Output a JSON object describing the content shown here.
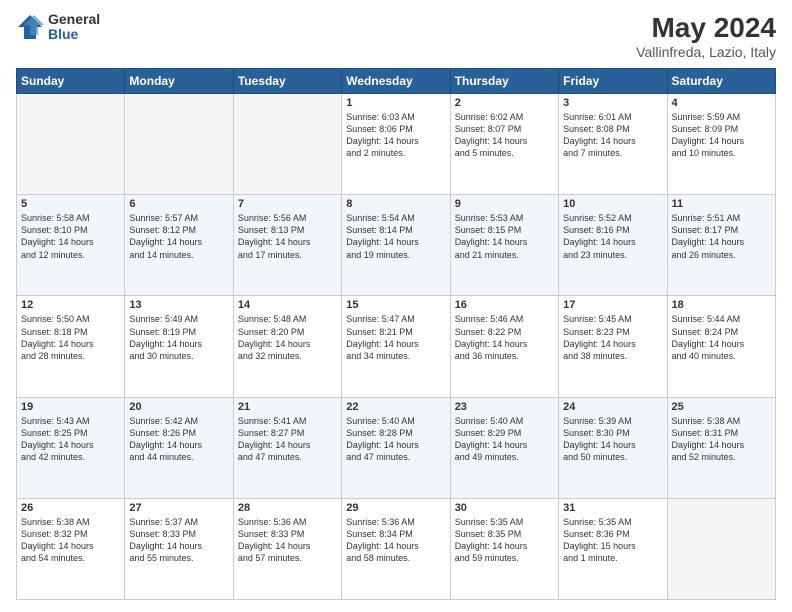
{
  "logo": {
    "general": "General",
    "blue": "Blue"
  },
  "header": {
    "title": "May 2024",
    "subtitle": "Vallinfreda, Lazio, Italy"
  },
  "weekdays": [
    "Sunday",
    "Monday",
    "Tuesday",
    "Wednesday",
    "Thursday",
    "Friday",
    "Saturday"
  ],
  "weeks": [
    [
      {
        "day": "",
        "info": ""
      },
      {
        "day": "",
        "info": ""
      },
      {
        "day": "",
        "info": ""
      },
      {
        "day": "1",
        "info": "Sunrise: 6:03 AM\nSunset: 8:06 PM\nDaylight: 14 hours\nand 2 minutes."
      },
      {
        "day": "2",
        "info": "Sunrise: 6:02 AM\nSunset: 8:07 PM\nDaylight: 14 hours\nand 5 minutes."
      },
      {
        "day": "3",
        "info": "Sunrise: 6:01 AM\nSunset: 8:08 PM\nDaylight: 14 hours\nand 7 minutes."
      },
      {
        "day": "4",
        "info": "Sunrise: 5:59 AM\nSunset: 8:09 PM\nDaylight: 14 hours\nand 10 minutes."
      }
    ],
    [
      {
        "day": "5",
        "info": "Sunrise: 5:58 AM\nSunset: 8:10 PM\nDaylight: 14 hours\nand 12 minutes."
      },
      {
        "day": "6",
        "info": "Sunrise: 5:57 AM\nSunset: 8:12 PM\nDaylight: 14 hours\nand 14 minutes."
      },
      {
        "day": "7",
        "info": "Sunrise: 5:56 AM\nSunset: 8:13 PM\nDaylight: 14 hours\nand 17 minutes."
      },
      {
        "day": "8",
        "info": "Sunrise: 5:54 AM\nSunset: 8:14 PM\nDaylight: 14 hours\nand 19 minutes."
      },
      {
        "day": "9",
        "info": "Sunrise: 5:53 AM\nSunset: 8:15 PM\nDaylight: 14 hours\nand 21 minutes."
      },
      {
        "day": "10",
        "info": "Sunrise: 5:52 AM\nSunset: 8:16 PM\nDaylight: 14 hours\nand 23 minutes."
      },
      {
        "day": "11",
        "info": "Sunrise: 5:51 AM\nSunset: 8:17 PM\nDaylight: 14 hours\nand 26 minutes."
      }
    ],
    [
      {
        "day": "12",
        "info": "Sunrise: 5:50 AM\nSunset: 8:18 PM\nDaylight: 14 hours\nand 28 minutes."
      },
      {
        "day": "13",
        "info": "Sunrise: 5:49 AM\nSunset: 8:19 PM\nDaylight: 14 hours\nand 30 minutes."
      },
      {
        "day": "14",
        "info": "Sunrise: 5:48 AM\nSunset: 8:20 PM\nDaylight: 14 hours\nand 32 minutes."
      },
      {
        "day": "15",
        "info": "Sunrise: 5:47 AM\nSunset: 8:21 PM\nDaylight: 14 hours\nand 34 minutes."
      },
      {
        "day": "16",
        "info": "Sunrise: 5:46 AM\nSunset: 8:22 PM\nDaylight: 14 hours\nand 36 minutes."
      },
      {
        "day": "17",
        "info": "Sunrise: 5:45 AM\nSunset: 8:23 PM\nDaylight: 14 hours\nand 38 minutes."
      },
      {
        "day": "18",
        "info": "Sunrise: 5:44 AM\nSunset: 8:24 PM\nDaylight: 14 hours\nand 40 minutes."
      }
    ],
    [
      {
        "day": "19",
        "info": "Sunrise: 5:43 AM\nSunset: 8:25 PM\nDaylight: 14 hours\nand 42 minutes."
      },
      {
        "day": "20",
        "info": "Sunrise: 5:42 AM\nSunset: 8:26 PM\nDaylight: 14 hours\nand 44 minutes."
      },
      {
        "day": "21",
        "info": "Sunrise: 5:41 AM\nSunset: 8:27 PM\nDaylight: 14 hours\nand 47 minutes."
      },
      {
        "day": "22",
        "info": "Sunrise: 5:40 AM\nSunset: 8:28 PM\nDaylight: 14 hours\nand 47 minutes."
      },
      {
        "day": "23",
        "info": "Sunrise: 5:40 AM\nSunset: 8:29 PM\nDaylight: 14 hours\nand 49 minutes."
      },
      {
        "day": "24",
        "info": "Sunrise: 5:39 AM\nSunset: 8:30 PM\nDaylight: 14 hours\nand 50 minutes."
      },
      {
        "day": "25",
        "info": "Sunrise: 5:38 AM\nSunset: 8:31 PM\nDaylight: 14 hours\nand 52 minutes."
      }
    ],
    [
      {
        "day": "26",
        "info": "Sunrise: 5:38 AM\nSunset: 8:32 PM\nDaylight: 14 hours\nand 54 minutes."
      },
      {
        "day": "27",
        "info": "Sunrise: 5:37 AM\nSunset: 8:33 PM\nDaylight: 14 hours\nand 55 minutes."
      },
      {
        "day": "28",
        "info": "Sunrise: 5:36 AM\nSunset: 8:33 PM\nDaylight: 14 hours\nand 57 minutes."
      },
      {
        "day": "29",
        "info": "Sunrise: 5:36 AM\nSunset: 8:34 PM\nDaylight: 14 hours\nand 58 minutes."
      },
      {
        "day": "30",
        "info": "Sunrise: 5:35 AM\nSunset: 8:35 PM\nDaylight: 14 hours\nand 59 minutes."
      },
      {
        "day": "31",
        "info": "Sunrise: 5:35 AM\nSunset: 8:36 PM\nDaylight: 15 hours\nand 1 minute."
      },
      {
        "day": "",
        "info": ""
      }
    ]
  ]
}
